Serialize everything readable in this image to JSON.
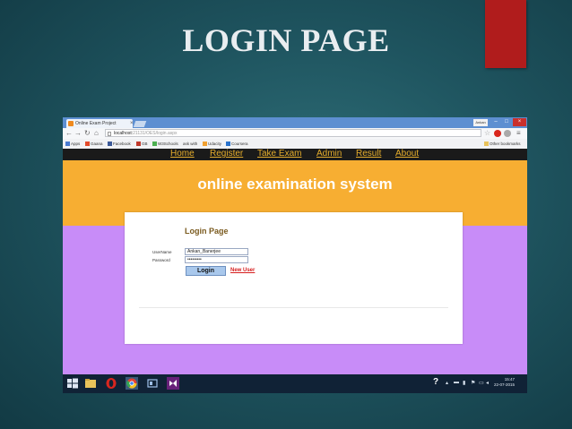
{
  "slide": {
    "title": "LOGIN PAGE"
  },
  "browser": {
    "tab_title": "Online Exam Project",
    "tab_close": "×",
    "user_label": "Ankan",
    "window_controls": [
      "–",
      "□",
      "×"
    ],
    "url_host": "localhost:",
    "url_path": "21131/OES/login.aspx",
    "bookmarks": [
      "Apps",
      "Gaana",
      "Facebook",
      "GB",
      "W3Schools",
      "ask with",
      "Udacity",
      "Coursera"
    ],
    "other_bookmarks": "Other bookmarks"
  },
  "site": {
    "nav": [
      "Home",
      "Register",
      "Take Exam",
      "Admin",
      "Result",
      "About"
    ],
    "banner_title": "online examination system",
    "login": {
      "title": "Login Page",
      "username_label": "UserName",
      "username_value": "Ankan_Banerjee",
      "password_label": "Password",
      "password_value": "•••••••••",
      "login_button": "Login",
      "new_user_link": "New User"
    }
  },
  "taskbar": {
    "tray_help": "?",
    "clock_time": "15:47",
    "clock_date": "22-07-2015"
  },
  "colors": {
    "slide_bg": "#1f5560",
    "accent_red": "#b01c1c",
    "nav_bg": "#1a1a1a",
    "nav_link": "#e5ad2c",
    "banner": "#f7ae32",
    "page_bg": "#c88cf8",
    "new_user": "#d61e1e"
  }
}
